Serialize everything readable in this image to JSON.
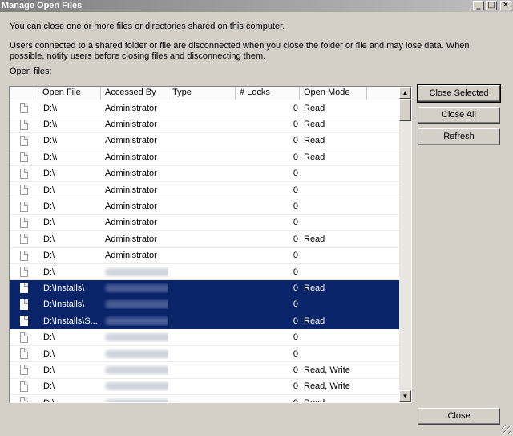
{
  "window": {
    "title": "Manage Open Files"
  },
  "description": {
    "line1": "You can close one or more files or directories shared on this computer.",
    "line2": "Users connected to a shared folder or file are disconnected when you close the folder or file and may lose data. When possible, notify users before closing files and disconnecting them."
  },
  "list": {
    "label": "Open files:",
    "columns": [
      "Open File",
      "Accessed By",
      "Type",
      "# Locks",
      "Open Mode"
    ],
    "rows": [
      {
        "file": "D:\\\\",
        "user": "Administrator",
        "type": "",
        "locks": "0",
        "mode": "Read",
        "selected": false,
        "blurred": false
      },
      {
        "file": "D:\\\\",
        "user": "Administrator",
        "type": "",
        "locks": "0",
        "mode": "Read",
        "selected": false,
        "blurred": false
      },
      {
        "file": "D:\\\\",
        "user": "Administrator",
        "type": "",
        "locks": "0",
        "mode": "Read",
        "selected": false,
        "blurred": false
      },
      {
        "file": "D:\\\\",
        "user": "Administrator",
        "type": "",
        "locks": "0",
        "mode": "Read",
        "selected": false,
        "blurred": false
      },
      {
        "file": "D:\\",
        "user": "Administrator",
        "type": "",
        "locks": "0",
        "mode": "",
        "selected": false,
        "blurred": false
      },
      {
        "file": "D:\\",
        "user": "Administrator",
        "type": "",
        "locks": "0",
        "mode": "",
        "selected": false,
        "blurred": false
      },
      {
        "file": "D:\\",
        "user": "Administrator",
        "type": "",
        "locks": "0",
        "mode": "",
        "selected": false,
        "blurred": false
      },
      {
        "file": "D:\\",
        "user": "Administrator",
        "type": "",
        "locks": "0",
        "mode": "",
        "selected": false,
        "blurred": false
      },
      {
        "file": "D:\\",
        "user": "Administrator",
        "type": "",
        "locks": "0",
        "mode": "Read",
        "selected": false,
        "blurred": false
      },
      {
        "file": "D:\\",
        "user": "Administrator",
        "type": "",
        "locks": "0",
        "mode": "",
        "selected": false,
        "blurred": false
      },
      {
        "file": "D:\\",
        "user": "",
        "type": "",
        "locks": "0",
        "mode": "",
        "selected": false,
        "blurred": true
      },
      {
        "file": "D:\\Installs\\",
        "user": "",
        "type": "",
        "locks": "0",
        "mode": "Read",
        "selected": true,
        "blurred": true
      },
      {
        "file": "D:\\Installs\\",
        "user": "",
        "type": "",
        "locks": "0",
        "mode": "",
        "selected": true,
        "blurred": true
      },
      {
        "file": "D:\\Installs\\S...",
        "user": "",
        "type": "",
        "locks": "0",
        "mode": "Read",
        "selected": true,
        "blurred": true
      },
      {
        "file": "D:\\",
        "user": "",
        "type": "",
        "locks": "0",
        "mode": "",
        "selected": false,
        "blurred": true
      },
      {
        "file": "D:\\",
        "user": "",
        "type": "",
        "locks": "0",
        "mode": "",
        "selected": false,
        "blurred": true
      },
      {
        "file": "D:\\",
        "user": "",
        "type": "",
        "locks": "0",
        "mode": "Read, Write",
        "selected": false,
        "blurred": true
      },
      {
        "file": "D:\\",
        "user": "",
        "type": "",
        "locks": "0",
        "mode": "Read, Write",
        "selected": false,
        "blurred": true
      },
      {
        "file": "D:\\",
        "user": "",
        "type": "",
        "locks": "0",
        "mode": "Read",
        "selected": false,
        "blurred": true
      }
    ]
  },
  "buttons": {
    "close_selected": "Close Selected",
    "close_all": "Close All",
    "refresh": "Refresh",
    "close": "Close"
  },
  "titlebar_buttons": {
    "minimize": "_",
    "maximize": "□",
    "close": "✕"
  },
  "icons": {
    "row": "file-icon",
    "scroll_up": "arrow-up-icon",
    "scroll_down": "arrow-down-icon"
  },
  "colors": {
    "selection": "#0a246a",
    "dialog": "#d4d0c8"
  }
}
